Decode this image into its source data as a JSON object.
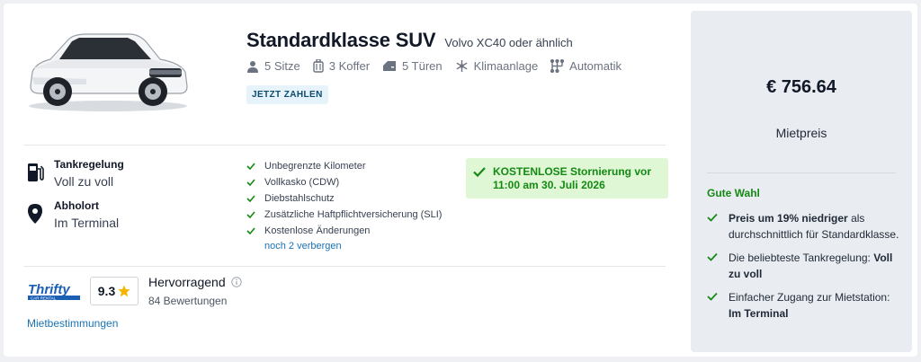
{
  "car": {
    "title": "Standardklasse SUV",
    "subtitle": "Volvo XC40 oder ähnlich",
    "features": [
      {
        "icon": "person-icon",
        "label": "5 Sitze"
      },
      {
        "icon": "suitcase-icon",
        "label": "3 Koffer"
      },
      {
        "icon": "door-icon",
        "label": "5 Türen"
      },
      {
        "icon": "snowflake-icon",
        "label": "Klimaanlage"
      },
      {
        "icon": "gearshift-icon",
        "label": "Automatik"
      }
    ],
    "pay_badge": "JETZT ZAHLEN"
  },
  "info": {
    "fuel_label": "Tankregelung",
    "fuel_value": "Voll zu voll",
    "pickup_label": "Abholort",
    "pickup_value": "Im Terminal"
  },
  "included": {
    "items": [
      "Unbegrenzte Kilometer",
      "Vollkasko (CDW)",
      "Diebstahlschutz",
      "Zusätzliche Haftpflichtversicherung (SLI)",
      "Kostenlose Änderungen"
    ],
    "more_link": "noch 2 verbergen"
  },
  "cancellation": {
    "text": "KOSTENLOSE Stornierung vor 11:00 am 30. Juli 2026"
  },
  "supplier": {
    "logo_text": "Thrifty",
    "logo_sub": "CAR RENTAL",
    "score": "9.3",
    "rating_label": "Hervorragend",
    "reviews": "84 Bewertungen",
    "terms_link": "Mietbestimmungen"
  },
  "price_panel": {
    "price": "€ 756.64",
    "price_label": "Mietpreis",
    "good_title": "Gute Wahl",
    "points": [
      {
        "bold": "Preis um 19% niedriger",
        "rest": " als durchschnittlich für Standardklasse."
      },
      {
        "pre": "Die beliebteste Tankregelung: ",
        "bold": "Voll zu voll"
      },
      {
        "pre": "Einfacher Zugang zur Mietstation: ",
        "bold": "Im Terminal"
      }
    ]
  },
  "colors": {
    "accent_green": "#148a14",
    "link_blue": "#1a73b5",
    "badge_bg": "#e6f3fa",
    "cancel_bg": "#dff7d4",
    "star": "#f5b400"
  }
}
